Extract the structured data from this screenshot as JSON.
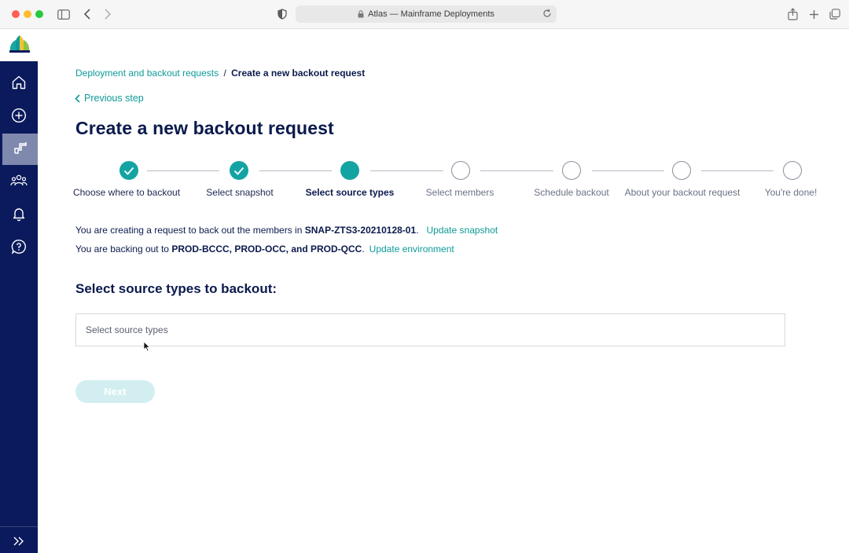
{
  "browser": {
    "url_title": "Atlas — Mainframe Deployments"
  },
  "breadcrumb": {
    "parent": "Deployment and backout requests",
    "separator": "/",
    "current": "Create a new backout request"
  },
  "previous_step_label": "Previous step",
  "page_title": "Create a new backout request",
  "steps": [
    {
      "label": "Choose where to backout",
      "state": "done"
    },
    {
      "label": "Select snapshot",
      "state": "done"
    },
    {
      "label": "Select source types",
      "state": "current"
    },
    {
      "label": "Select members",
      "state": "todo"
    },
    {
      "label": "Schedule backout",
      "state": "todo"
    },
    {
      "label": "About your backout request",
      "state": "todo"
    },
    {
      "label": "You're done!",
      "state": "todo"
    }
  ],
  "info": {
    "line1_prefix": "You are creating a request to back out the members in ",
    "line1_snapshot": "SNAP-ZTS3-20210128-01",
    "line1_suffix": ".",
    "line1_action": "Update snapshot",
    "line2_prefix": "You are backing out to ",
    "line2_env": "PROD-BCCC, PROD-OCC, and PROD-QCC",
    "line2_suffix": ".",
    "line2_action": "Update environment"
  },
  "section_title": "Select source types to backout:",
  "source_types_select": {
    "placeholder": "Select source types"
  },
  "next_button_label": "Next",
  "sidebar": {
    "items": [
      {
        "icon": "home-icon",
        "active": false
      },
      {
        "icon": "add-circle-icon",
        "active": false
      },
      {
        "icon": "deployment-icon",
        "active": true
      },
      {
        "icon": "people-icon",
        "active": false
      },
      {
        "icon": "bell-icon",
        "active": false
      },
      {
        "icon": "help-icon",
        "active": false
      }
    ],
    "expand_icon": "double-chevron-right-icon"
  },
  "colors": {
    "accent_teal": "#14a3a3",
    "link_teal": "#0e9a9a",
    "navy": "#0b1a4d",
    "sidebar_bg": "#0b1a5c",
    "sidebar_active": "#7f88ad",
    "disabled_button": "#d2eef0"
  }
}
